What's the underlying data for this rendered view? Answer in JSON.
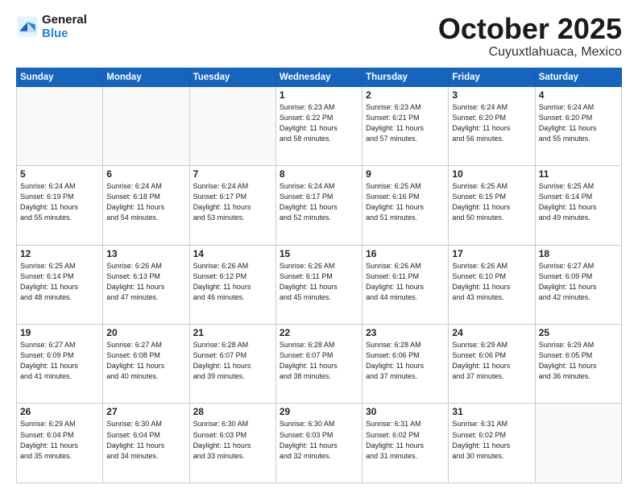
{
  "logo": {
    "line1": "General",
    "line2": "Blue"
  },
  "title": "October 2025",
  "subtitle": "Cuyuxtlahuaca, Mexico",
  "days_of_week": [
    "Sunday",
    "Monday",
    "Tuesday",
    "Wednesday",
    "Thursday",
    "Friday",
    "Saturday"
  ],
  "weeks": [
    [
      {
        "day": "",
        "info": ""
      },
      {
        "day": "",
        "info": ""
      },
      {
        "day": "",
        "info": ""
      },
      {
        "day": "1",
        "info": "Sunrise: 6:23 AM\nSunset: 6:22 PM\nDaylight: 11 hours\nand 58 minutes."
      },
      {
        "day": "2",
        "info": "Sunrise: 6:23 AM\nSunset: 6:21 PM\nDaylight: 11 hours\nand 57 minutes."
      },
      {
        "day": "3",
        "info": "Sunrise: 6:24 AM\nSunset: 6:20 PM\nDaylight: 11 hours\nand 56 minutes."
      },
      {
        "day": "4",
        "info": "Sunrise: 6:24 AM\nSunset: 6:20 PM\nDaylight: 11 hours\nand 55 minutes."
      }
    ],
    [
      {
        "day": "5",
        "info": "Sunrise: 6:24 AM\nSunset: 6:19 PM\nDaylight: 11 hours\nand 55 minutes."
      },
      {
        "day": "6",
        "info": "Sunrise: 6:24 AM\nSunset: 6:18 PM\nDaylight: 11 hours\nand 54 minutes."
      },
      {
        "day": "7",
        "info": "Sunrise: 6:24 AM\nSunset: 6:17 PM\nDaylight: 11 hours\nand 53 minutes."
      },
      {
        "day": "8",
        "info": "Sunrise: 6:24 AM\nSunset: 6:17 PM\nDaylight: 11 hours\nand 52 minutes."
      },
      {
        "day": "9",
        "info": "Sunrise: 6:25 AM\nSunset: 6:16 PM\nDaylight: 11 hours\nand 51 minutes."
      },
      {
        "day": "10",
        "info": "Sunrise: 6:25 AM\nSunset: 6:15 PM\nDaylight: 11 hours\nand 50 minutes."
      },
      {
        "day": "11",
        "info": "Sunrise: 6:25 AM\nSunset: 6:14 PM\nDaylight: 11 hours\nand 49 minutes."
      }
    ],
    [
      {
        "day": "12",
        "info": "Sunrise: 6:25 AM\nSunset: 6:14 PM\nDaylight: 11 hours\nand 48 minutes."
      },
      {
        "day": "13",
        "info": "Sunrise: 6:26 AM\nSunset: 6:13 PM\nDaylight: 11 hours\nand 47 minutes."
      },
      {
        "day": "14",
        "info": "Sunrise: 6:26 AM\nSunset: 6:12 PM\nDaylight: 11 hours\nand 46 minutes."
      },
      {
        "day": "15",
        "info": "Sunrise: 6:26 AM\nSunset: 6:11 PM\nDaylight: 11 hours\nand 45 minutes."
      },
      {
        "day": "16",
        "info": "Sunrise: 6:26 AM\nSunset: 6:11 PM\nDaylight: 11 hours\nand 44 minutes."
      },
      {
        "day": "17",
        "info": "Sunrise: 6:26 AM\nSunset: 6:10 PM\nDaylight: 11 hours\nand 43 minutes."
      },
      {
        "day": "18",
        "info": "Sunrise: 6:27 AM\nSunset: 6:09 PM\nDaylight: 11 hours\nand 42 minutes."
      }
    ],
    [
      {
        "day": "19",
        "info": "Sunrise: 6:27 AM\nSunset: 6:09 PM\nDaylight: 11 hours\nand 41 minutes."
      },
      {
        "day": "20",
        "info": "Sunrise: 6:27 AM\nSunset: 6:08 PM\nDaylight: 11 hours\nand 40 minutes."
      },
      {
        "day": "21",
        "info": "Sunrise: 6:28 AM\nSunset: 6:07 PM\nDaylight: 11 hours\nand 39 minutes."
      },
      {
        "day": "22",
        "info": "Sunrise: 6:28 AM\nSunset: 6:07 PM\nDaylight: 11 hours\nand 38 minutes."
      },
      {
        "day": "23",
        "info": "Sunrise: 6:28 AM\nSunset: 6:06 PM\nDaylight: 11 hours\nand 37 minutes."
      },
      {
        "day": "24",
        "info": "Sunrise: 6:29 AM\nSunset: 6:06 PM\nDaylight: 11 hours\nand 37 minutes."
      },
      {
        "day": "25",
        "info": "Sunrise: 6:29 AM\nSunset: 6:05 PM\nDaylight: 11 hours\nand 36 minutes."
      }
    ],
    [
      {
        "day": "26",
        "info": "Sunrise: 6:29 AM\nSunset: 6:04 PM\nDaylight: 11 hours\nand 35 minutes."
      },
      {
        "day": "27",
        "info": "Sunrise: 6:30 AM\nSunset: 6:04 PM\nDaylight: 11 hours\nand 34 minutes."
      },
      {
        "day": "28",
        "info": "Sunrise: 6:30 AM\nSunset: 6:03 PM\nDaylight: 11 hours\nand 33 minutes."
      },
      {
        "day": "29",
        "info": "Sunrise: 6:30 AM\nSunset: 6:03 PM\nDaylight: 11 hours\nand 32 minutes."
      },
      {
        "day": "30",
        "info": "Sunrise: 6:31 AM\nSunset: 6:02 PM\nDaylight: 11 hours\nand 31 minutes."
      },
      {
        "day": "31",
        "info": "Sunrise: 6:31 AM\nSunset: 6:02 PM\nDaylight: 11 hours\nand 30 minutes."
      },
      {
        "day": "",
        "info": ""
      }
    ]
  ]
}
